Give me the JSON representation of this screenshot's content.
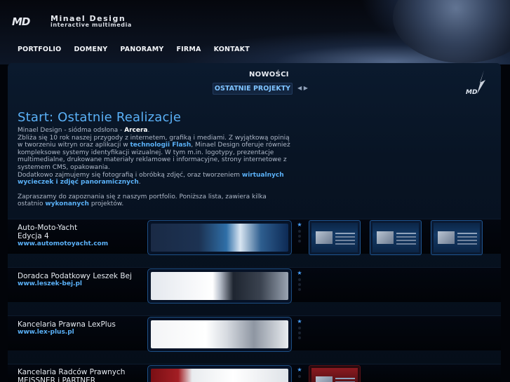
{
  "brand": {
    "mark": "MD",
    "name": "Minael Design",
    "tagline": "interactive multimedia"
  },
  "nav": [
    {
      "label": "PORTFOLIO"
    },
    {
      "label": "DOMENY"
    },
    {
      "label": "PANORAMY"
    },
    {
      "label": "FIRMA"
    },
    {
      "label": "KONTAKT"
    }
  ],
  "subnav": {
    "news": "NOWOŚCI",
    "projects": "OSTATNIE PROJEKTY",
    "arrows": "◀ ▶"
  },
  "intro": {
    "title": "Start: Ostatnie Realizacje",
    "line1_prefix": "Minael Design - siódma odsłona - ",
    "line1_bold": "Arcera",
    "line1_suffix": ".",
    "para1_a": "Zbliża się 10 rok naszej przygody z internetem, grafiką i mediami. Z wyjątkową opinią w tworzeniu witryn oraz aplikacji w ",
    "para1_link": "technologii Flash",
    "para1_b": ", Minael Design oferuje również kompleksowe systemy identyfikacji wizualnej. W tym m.in. logotypy, prezentacje multimedialne, drukowane materiały reklamowe i informacyjne, strony internetowe z systemem CMS, opakowania.",
    "para2_a": "Dodatkowo zajmujemy się fotografią i obróbką zdjęć, oraz tworzeniem ",
    "para2_link": "wirtualnych wycieczek i zdjęć panoramicznych",
    "para2_b": ".",
    "para3_a": "Zapraszamy do zapoznania się z naszym portfolio. Poniższa lista, zawiera kilka ostatnio ",
    "para3_link": "wykonanych",
    "para3_b": " projektów."
  },
  "projects": [
    {
      "title": "Auto-Moto-Yacht",
      "title2": "Edycja 4",
      "url": "www.automotoyacht.com"
    },
    {
      "title": "Doradca Podatkowy Leszek Bej",
      "title2": "",
      "url": "www.leszek-bej.pl"
    },
    {
      "title": "Kancelaria Prawna LexPlus",
      "title2": "",
      "url": "www.lex-plus.pl"
    },
    {
      "title": "Kancelaria Radców Prawnych",
      "title2": "MEISSNER i PARTNER",
      "url": ""
    }
  ],
  "colors": {
    "accent": "#5ab0f6",
    "background": "#020409",
    "panel": "#081424"
  }
}
